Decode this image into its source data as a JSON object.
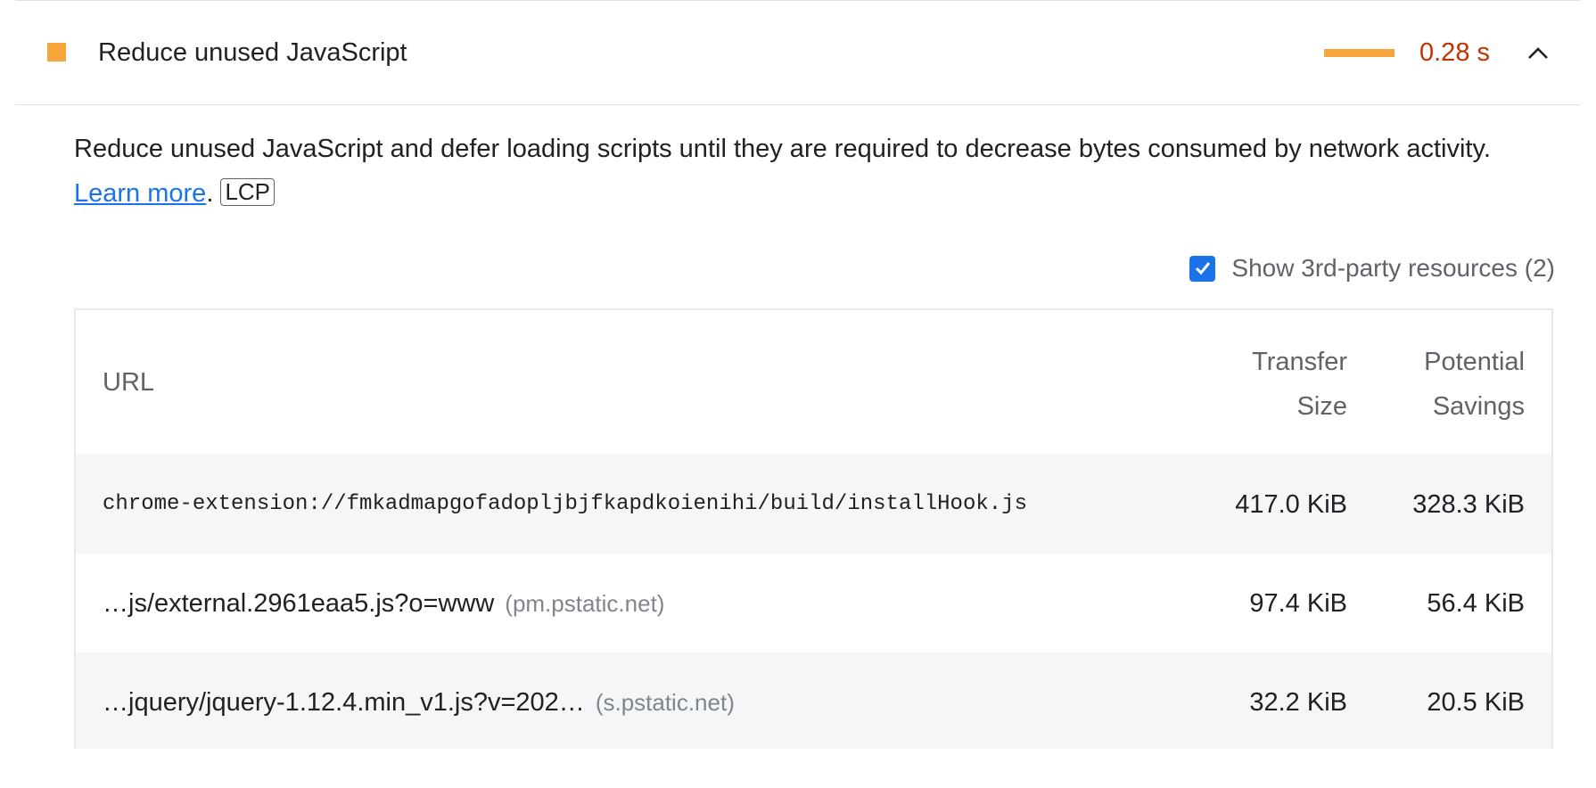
{
  "audit": {
    "title": "Reduce unused JavaScript",
    "savings_display": "0.28 s",
    "score_color": "#f6a53a",
    "savings_color": "#c33300",
    "expanded_icon": "chevron-up-icon"
  },
  "description": {
    "text": "Reduce unused JavaScript and defer loading scripts until they are required to decrease bytes consumed by network activity. ",
    "link_text": "Learn more",
    "after_link": ".",
    "badge": "LCP",
    "link_color": "#1a73e8"
  },
  "filter": {
    "label": "Show 3rd-party resources (2)",
    "checked": true
  },
  "table": {
    "headers": {
      "url": "URL",
      "transfer_line1": "Transfer",
      "transfer_line2": "Size",
      "savings_line1": "Potential",
      "savings_line2": "Savings"
    },
    "rows": [
      {
        "url": "chrome-extension://fmkadmapgofadopljbjfkapdkoienihi/build/installHook.js",
        "origin": "",
        "transfer_size": "417.0 KiB",
        "potential_savings": "328.3 KiB"
      },
      {
        "url": "…js/external.2961eaa5.js?o=www",
        "origin": "(pm.pstatic.net)",
        "transfer_size": "97.4 KiB",
        "potential_savings": "56.4 KiB"
      },
      {
        "url": "…jquery/jquery-1.12.4.min_v1.js?v=202…",
        "origin": "(s.pstatic.net)",
        "transfer_size": "32.2 KiB",
        "potential_savings": "20.5 KiB"
      }
    ]
  }
}
